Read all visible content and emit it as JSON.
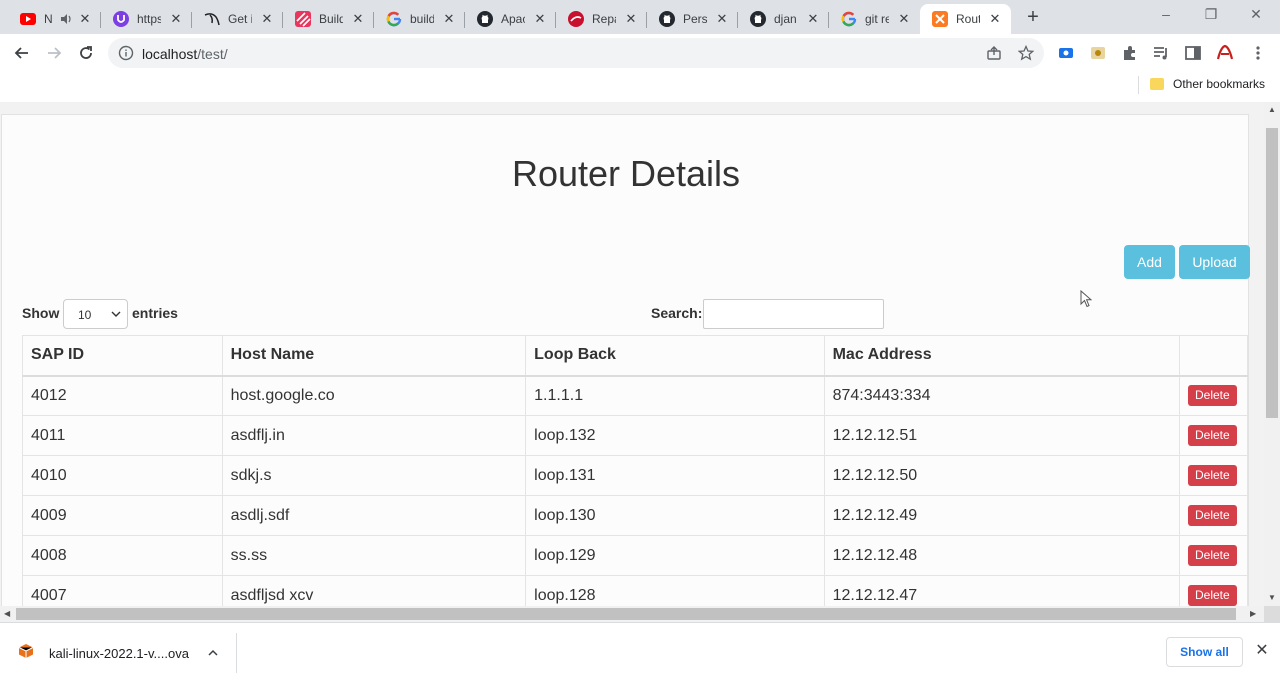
{
  "browser": {
    "tabs": [
      {
        "title": "N",
        "icon": "youtube-icon",
        "close": "✕"
      },
      {
        "title": "https",
        "icon": "purple-u-icon",
        "close": "✕"
      },
      {
        "title": "Get i",
        "icon": "kali-dragon-icon",
        "close": "✕"
      },
      {
        "title": "Build",
        "icon": "striped-logo-icon",
        "close": "✕"
      },
      {
        "title": "build",
        "icon": "google-icon",
        "close": "✕"
      },
      {
        "title": "Apac",
        "icon": "github-icon",
        "close": "✕"
      },
      {
        "title": "Repa",
        "icon": "red-logo-icon",
        "close": "✕"
      },
      {
        "title": "Perso",
        "icon": "github-icon",
        "close": "✕"
      },
      {
        "title": "djan",
        "icon": "github-icon",
        "close": "✕"
      },
      {
        "title": "git re",
        "icon": "google-icon",
        "close": "✕"
      },
      {
        "title": "Route",
        "icon": "xampp-icon",
        "close": "✕",
        "active": true
      }
    ],
    "new_tab": "+",
    "window_controls": [
      "‒",
      "❐",
      "✕"
    ],
    "url_host": "localhost",
    "url_path": "/test/",
    "bookmarks": {
      "other": "Other bookmarks"
    }
  },
  "page": {
    "title": "Router Details",
    "buttons": {
      "add": "Add",
      "upload": "Upload"
    },
    "length": {
      "show": "Show",
      "value": "10",
      "entries": "entries"
    },
    "search": {
      "label": "Search:",
      "value": ""
    },
    "table": {
      "columns": [
        "SAP ID",
        "Host Name",
        "Loop Back",
        "Mac Address",
        ""
      ],
      "rows": [
        [
          "4012",
          "host.google.co",
          "1.1.1.1",
          "874:3443:334"
        ],
        [
          "4011",
          "asdflj.in",
          "loop.132",
          "12.12.12.51"
        ],
        [
          "4010",
          "sdkj.s",
          "loop.131",
          "12.12.12.50"
        ],
        [
          "4009",
          "asdlj.sdf",
          "loop.130",
          "12.12.12.49"
        ],
        [
          "4008",
          "ss.ss",
          "loop.129",
          "12.12.12.48"
        ],
        [
          "4007",
          "asdfljsd xcv",
          "loop.128",
          "12.12.12.47"
        ]
      ],
      "delete_label": "Delete"
    }
  },
  "download": {
    "filename": "kali-linux-2022.1-v....ova",
    "show_all": "Show all"
  },
  "colors": {
    "accent_button": "#5bc0de",
    "delete_button": "#d43f4a",
    "link_blue": "#1a73e8"
  }
}
